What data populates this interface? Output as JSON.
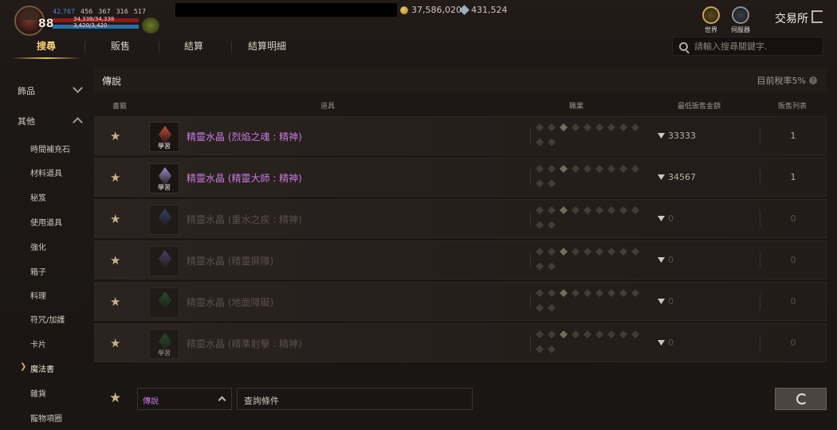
{
  "player": {
    "level": "88",
    "stat1": "42,767",
    "stat2": "456",
    "stat3": "367",
    "stat4": "316",
    "stat5": "517",
    "hp": "34,338/34,338",
    "mp": "3,420/3,420"
  },
  "currency": {
    "gold": "37,586,020",
    "gems": "431,524"
  },
  "top": {
    "world_label": "世界",
    "server_label": "伺服器",
    "title": "交易所"
  },
  "tabs": [
    "搜尋",
    "販售",
    "結算",
    "結算明細"
  ],
  "search": {
    "placeholder": "請輸入搜尋關鍵字."
  },
  "sidebar": {
    "cat_accessory": "飾品",
    "cat_other": "其他",
    "items": [
      "時間補充石",
      "材料道具",
      "秘笈",
      "使用道具",
      "強化",
      "箱子",
      "料理",
      "符咒/加護",
      "卡片",
      "魔法書",
      "雜貨",
      "寵物項圈"
    ],
    "active_index": 9
  },
  "main": {
    "title": "傳說",
    "tax": "目前稅率5%"
  },
  "columns": {
    "bookmark": "書籤",
    "item": "道具",
    "class": "職業",
    "min_price": "最低販售金額",
    "list": "販售列表"
  },
  "rows": [
    {
      "name": "精靈水晶 (烈焰之魂 : 精神)",
      "learn": "學習",
      "price": "33333",
      "count": "1",
      "color": "#c24a3a"
    },
    {
      "name": "精靈水晶 (精靈大師 : 精神)",
      "learn": "學習",
      "price": "34567",
      "count": "1",
      "color": "#a08ad0"
    },
    {
      "name": "精靈水晶 (重水之疾 : 精神)",
      "learn": "",
      "price": "0",
      "count": "0",
      "color": "#3a5a9a"
    },
    {
      "name": "精靈水晶 (精靈屏障)",
      "learn": "",
      "price": "0",
      "count": "0",
      "color": "#6a5a9a"
    },
    {
      "name": "精靈水晶 (地面障礙)",
      "learn": "",
      "price": "0",
      "count": "0",
      "color": "#2a6a3a"
    },
    {
      "name": "精靈水晶 (精準射擊 : 精神)",
      "learn": "學習",
      "price": "0",
      "count": "0",
      "color": "#2a6a3a"
    }
  ],
  "bottom": {
    "grade": "傳說",
    "query": "查詢條件"
  }
}
